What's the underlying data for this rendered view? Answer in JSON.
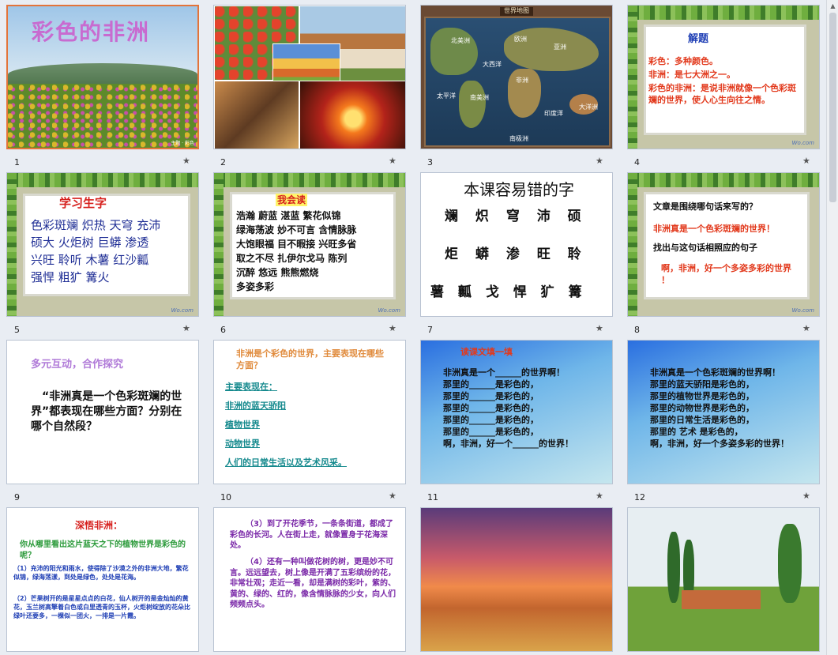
{
  "slide_numbers": [
    "1",
    "2",
    "3",
    "4",
    "5",
    "6",
    "7",
    "8",
    "9",
    "10",
    "11",
    "12"
  ],
  "anim_star": "★",
  "s1": {
    "title": "彩色的非洲"
  },
  "s3": {
    "map_title": "世界地图",
    "labels": [
      "北美洲",
      "欧洲",
      "亚洲",
      "大西洋",
      "非洲",
      "太平洋",
      "南美洲",
      "印度洋",
      "大洋洲",
      "南极洲"
    ]
  },
  "s4": {
    "heading": "解题",
    "lines": [
      "彩色：多种颜色。",
      "非洲：是七大洲之一。",
      "彩色的非洲：是说非洲就像一个色彩斑斓的世界，使人心生向往之情。"
    ]
  },
  "s5": {
    "heading": "学习生字",
    "rows": [
      "色彩斑斓 炽热 天穹 充沛",
      "硕大 火炬树 巨蟒 渗透",
      "兴旺 聆听 木薯 红沙瓤",
      "强悍 粗犷 篝火"
    ]
  },
  "s6": {
    "heading": "我会读",
    "rows": [
      "浩瀚 蔚蓝 湛蓝 繁花似锦",
      "绿海荡波 妙不可言 含情脉脉",
      "大饱眼福 目不暇接 兴旺多省",
      "取之不尽 扎伊尔戈马 陈列",
      "沉醉 悠远 熊熊燃烧",
      "多姿多彩"
    ]
  },
  "s7": {
    "heading": "本课容易错的字",
    "rows": [
      "斓 炽 穹 沛 硕",
      "炬 蟒 渗 旺 聆",
      "薯 瓤 戈 悍 犷 篝"
    ]
  },
  "s8": {
    "q1": "文章是围绕哪句话来写的？",
    "a1": "非洲真是一个色彩斑斓的世界！",
    "q2": "找出与这句话相照应的句子",
    "a2": "啊，非洲，好一个多姿多彩的世界 ！"
  },
  "s9": {
    "heading": "多元互动，合作探究",
    "body": "“非洲真是一个色彩斑斓的世界”都表现在哪些方面？分别在哪个自然段？"
  },
  "s10": {
    "question": "非洲是个彩色的世界，主要表现在哪些方面？",
    "intro": "主要表现在：",
    "items": [
      "非洲的蓝天骄阳",
      "植物世界",
      "动物世界",
      "人们的日常生活以及艺术风采。"
    ]
  },
  "s11": {
    "heading": "读课文填一填",
    "lines": [
      "非洲真是一个______的世界啊！",
      "那里的______是彩色的，",
      "那里的______是彩色的，",
      "那里的______是彩色的，",
      "那里的______是彩色的，",
      "那里的______是彩色的，",
      "啊，非洲，好一个______的世界！"
    ]
  },
  "s12": {
    "lines": [
      "非洲真是一个色彩斑斓的世界啊！",
      "那里的蓝天骄阳是彩色的，",
      "那里的植物世界是彩色的，",
      "那里的动物世界是彩色的，",
      "那里的日常生活是彩色的，",
      "那里的 艺术 是彩色的，",
      "啊，非洲，好一个多姿多彩的世界！"
    ]
  },
  "s13": {
    "heading": "深悟非洲：",
    "q": "你从哪里看出这片蓝天之下的植物世界是彩色的呢？",
    "p1": "（1）充沛的阳光和雨水，使得除了沙漠之外的非洲大地，繁花似锦，绿海荡漾，到处是绿色，处处是花海。",
    "p2": "（2）芒果树开的是星星点点的白花，仙人树开的是金灿灿的黄花，玉兰树高擎着白色或白里透青的玉杯，火炬树绽放的花朵比绿叶还要多，一棵似一团火，一排是一片霞。"
  },
  "s14": {
    "p1": "（3）到了开花季节，一条条街道，都成了彩色的长河。人在街上走，就像置身于花海深处。",
    "p2": "（4）还有一种叫做花树的树，更是妙不可言。远远望去，树上像是开满了五彩缤纷的花，非常壮观；走近一看，却是满树的彩叶，紫的、黄的、绿的、红的，像含情脉脉的少女，向人们频频点头。"
  }
}
